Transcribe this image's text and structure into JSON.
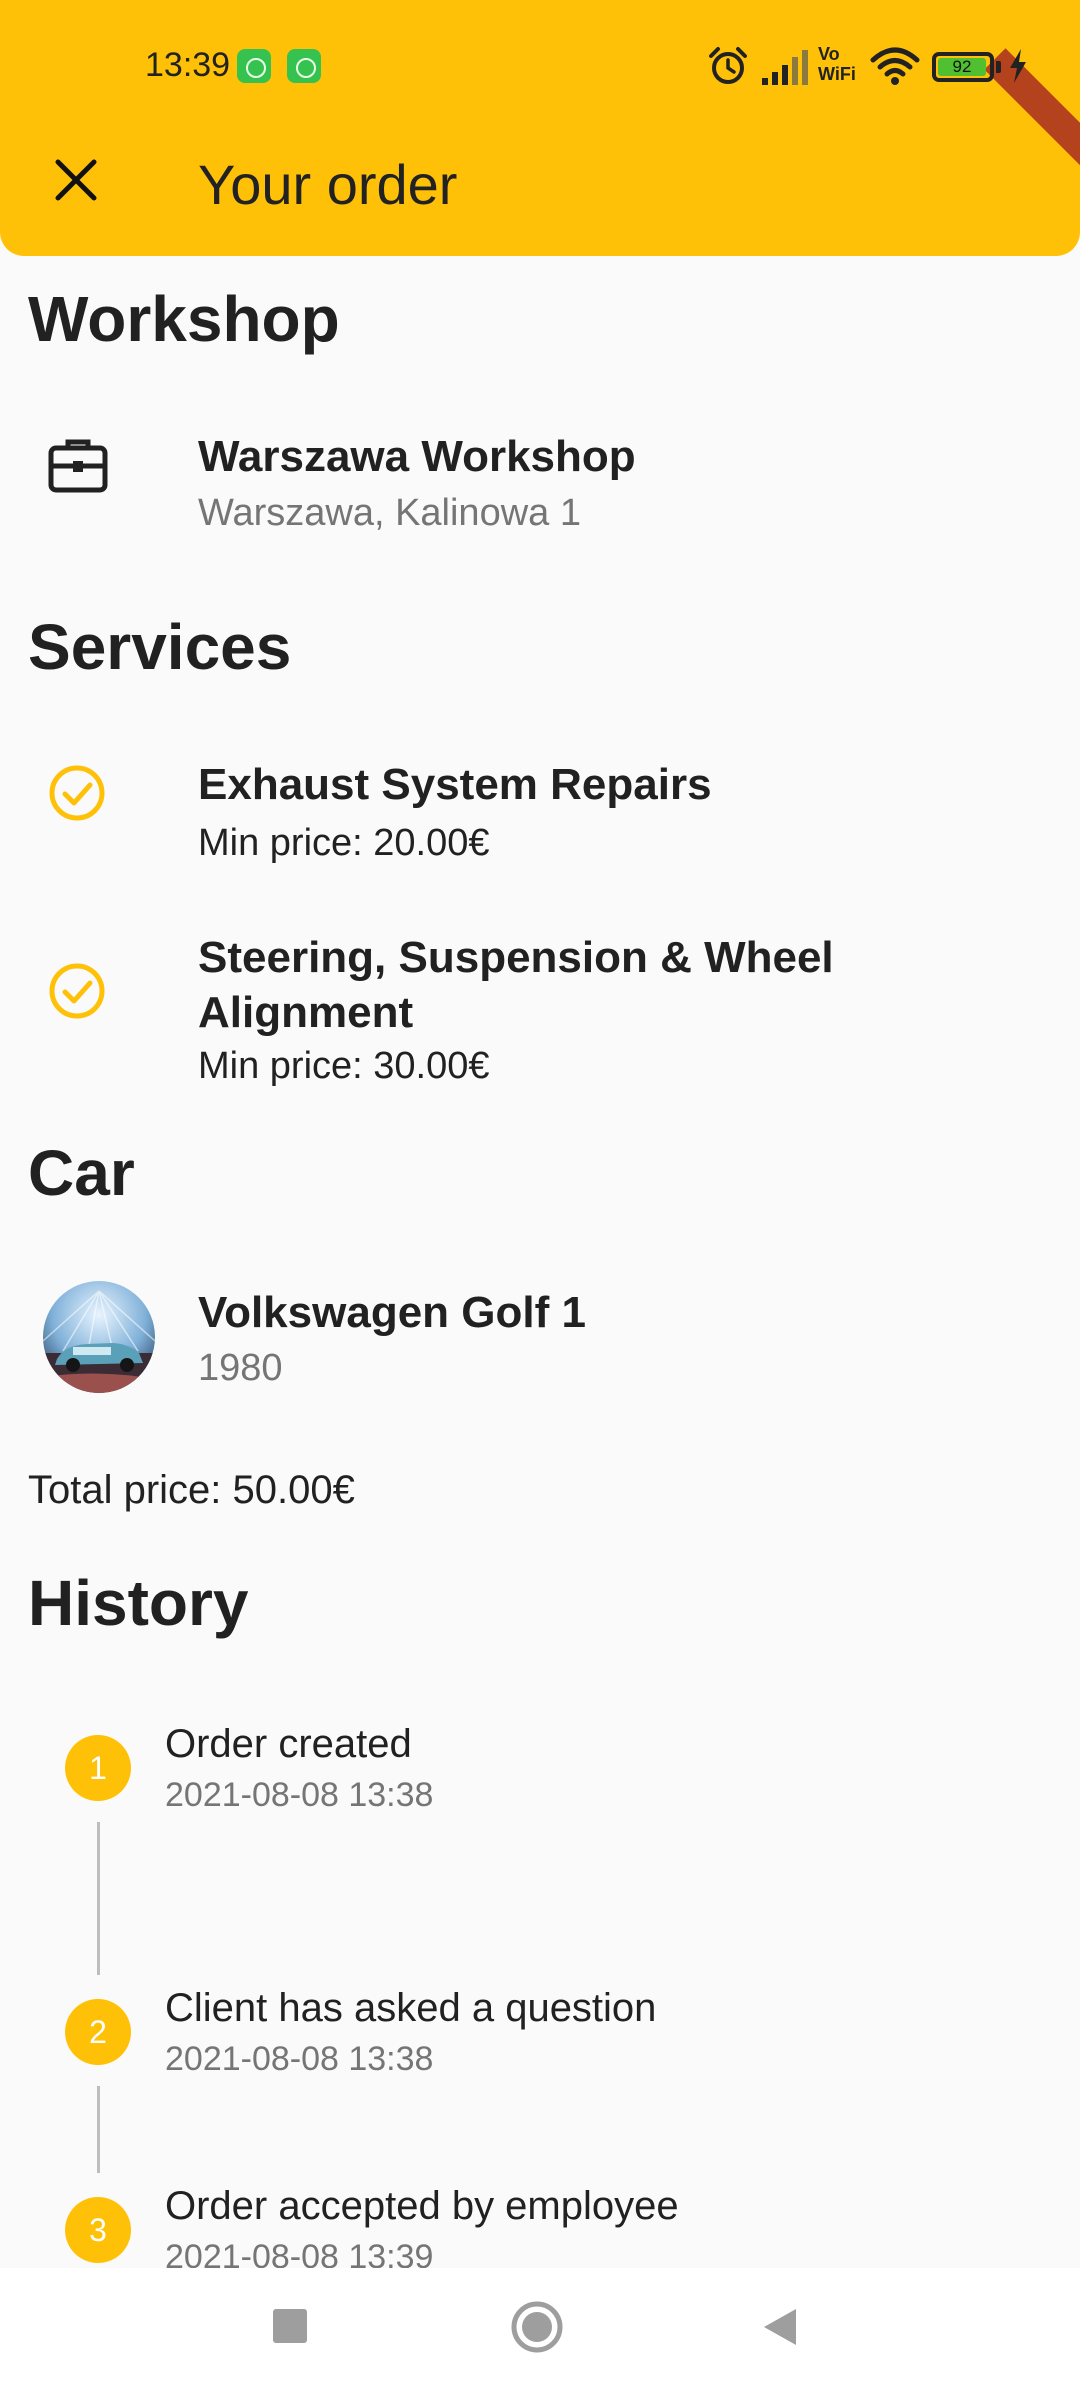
{
  "status_bar": {
    "time": "13:39",
    "battery": "92",
    "vowifi_line1": "Vo",
    "vowifi_line2": "WiFi",
    "icons": [
      "app-notification-icon",
      "app-notification-icon",
      "alarm-icon",
      "signal-icon",
      "vowifi-icon",
      "wifi-icon",
      "battery-icon",
      "charging-icon"
    ]
  },
  "app_bar": {
    "title": "Your order",
    "close_icon": "close-icon"
  },
  "workshop": {
    "heading": "Workshop",
    "name": "Warszawa Workshop",
    "address": "Warszawa, Kalinowa 1",
    "icon": "briefcase-icon"
  },
  "services": {
    "heading": "Services",
    "items": [
      {
        "name": "Exhaust System Repairs",
        "price": "Min price: 20.00€",
        "icon": "check-circle-icon"
      },
      {
        "name_line1": "Steering, Suspension & Wheel",
        "name_line2": "Alignment",
        "price": "Min price: 30.00€",
        "icon": "check-circle-icon"
      }
    ]
  },
  "car": {
    "heading": "Car",
    "name": "Volkswagen  Golf 1",
    "year": "1980"
  },
  "total_price": "Total price: 50.00€",
  "history": {
    "heading": "History",
    "steps": [
      {
        "number": "1",
        "title": "Order created",
        "time": "2021-08-08 13:38"
      },
      {
        "number": "2",
        "title": "Client has asked a question",
        "time": "2021-08-08 13:38"
      },
      {
        "number": "3",
        "title": "Order accepted by employee",
        "time": "2021-08-08 13:39"
      }
    ]
  },
  "nav_bar": {
    "icons": [
      "recents-icon",
      "home-icon",
      "back-icon"
    ]
  },
  "colors": {
    "accent": "#ffc107",
    "background": "#fafafa",
    "text": "#212121",
    "secondary_text": "#757575"
  }
}
